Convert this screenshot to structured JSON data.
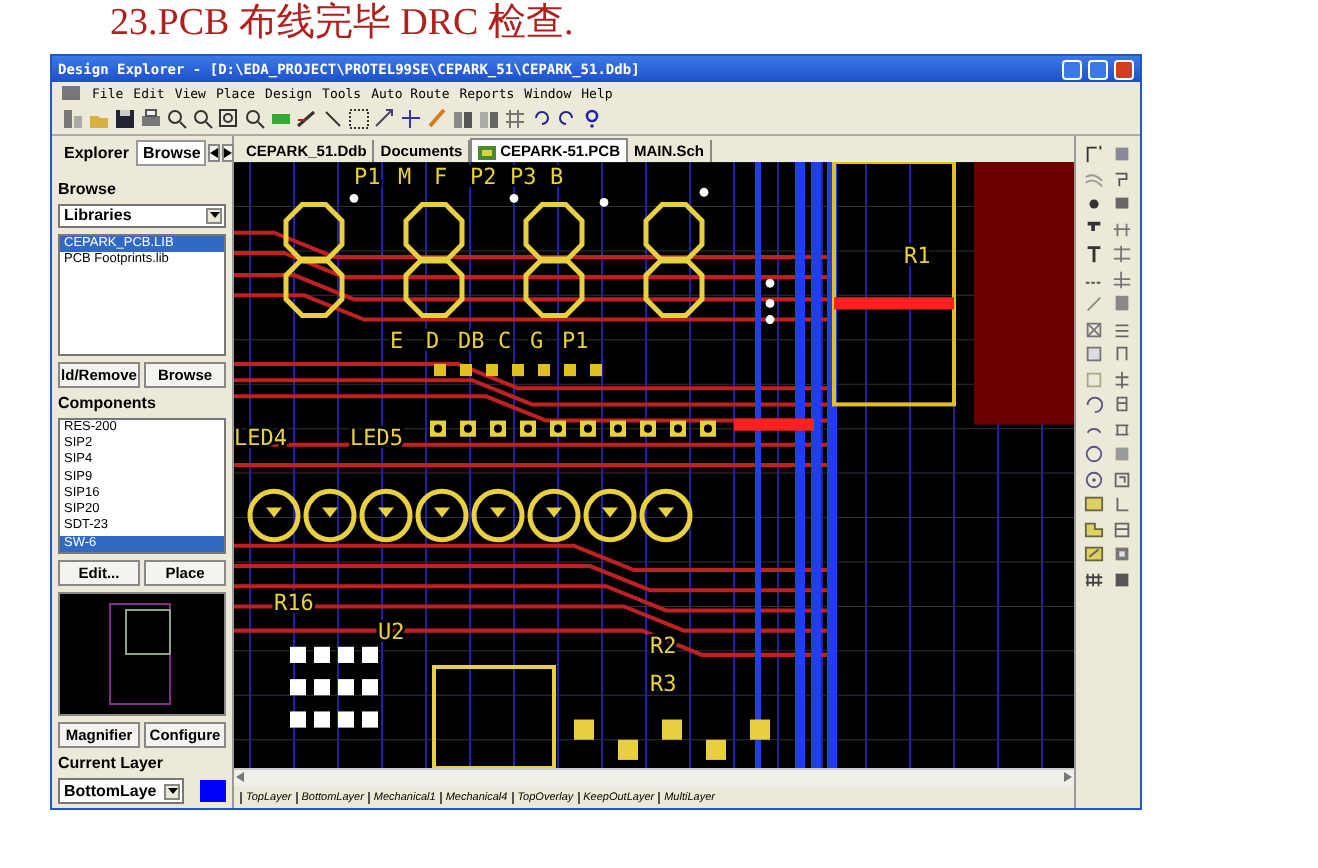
{
  "slide_title": "23.PCB 布线完毕 DRC 检查.",
  "window": {
    "title": "Design Explorer - [D:\\EDA_PROJECT\\PROTEL99SE\\CEPARK_51\\CEPARK_51.Ddb]"
  },
  "menu": [
    "File",
    "Edit",
    "View",
    "Place",
    "Design",
    "Tools",
    "Auto Route",
    "Reports",
    "Window",
    "Help"
  ],
  "panel_tabs": [
    {
      "label": "Explorer",
      "selected": false
    },
    {
      "label": "Browse",
      "selected": true
    }
  ],
  "browse": {
    "title": "Browse",
    "mode": "Libraries",
    "libraries": [
      {
        "label": "CEPARK_PCB.LIB",
        "selected": true
      },
      {
        "label": "PCB Footprints.lib",
        "selected": false
      }
    ],
    "buttons": [
      "ld/Remove",
      "Browse"
    ]
  },
  "components": {
    "title": "Components",
    "items": [
      {
        "label": "RES-200",
        "selected": false
      },
      {
        "label": "SIP2",
        "selected": false
      },
      {
        "label": "SIP4",
        "selected": false
      },
      {
        "label": "SIP9",
        "selected": false
      },
      {
        "label": "SIP16",
        "selected": false
      },
      {
        "label": "SIP20",
        "selected": false
      },
      {
        "label": "SDT-23",
        "selected": false
      },
      {
        "label": "SW-6",
        "selected": true
      }
    ],
    "buttons": [
      "Edit...",
      "Place"
    ]
  },
  "view_buttons": [
    "Magnifier",
    "Configure"
  ],
  "current_layer": {
    "title": "Current Layer",
    "value": "BottomLaye",
    "color": "#0000ff"
  },
  "doc_tabs": [
    {
      "label": "CEPARK_51.Ddb",
      "selected": false,
      "kind": "plain"
    },
    {
      "label": "Documents",
      "selected": false,
      "kind": "plain"
    },
    {
      "label": "CEPARK-51.PCB",
      "selected": true,
      "kind": "pcb"
    },
    {
      "label": "MAIN.Sch",
      "selected": false,
      "kind": "plain"
    }
  ],
  "pcb_labels": [
    "P1",
    "M",
    "F",
    "P2",
    "P3",
    "B",
    "R1",
    "E",
    "D",
    "DB",
    "C",
    "G",
    "P1",
    "LED4",
    "LED5",
    "R16",
    "U2",
    "R2",
    "R3"
  ],
  "layer_tabs": [
    "TopLayer",
    "BottomLayer",
    "Mechanical1",
    "Mechanical4",
    "TopOverlay",
    "KeepOutLayer",
    "MultiLayer"
  ]
}
